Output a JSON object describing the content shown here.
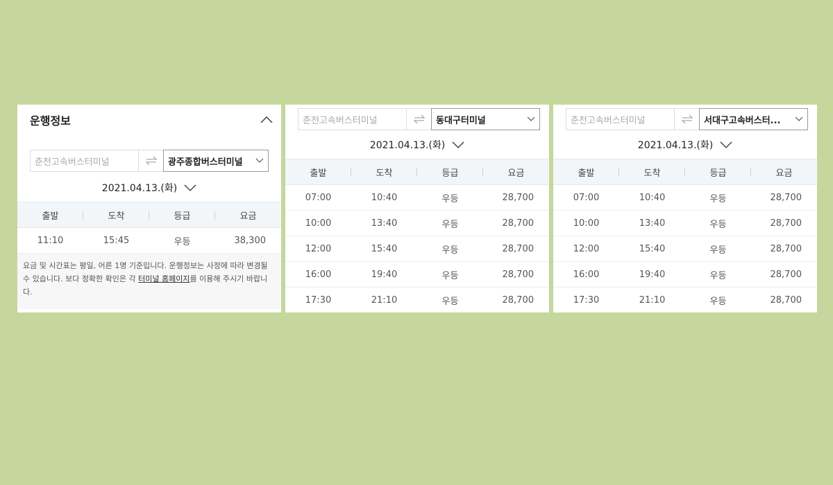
{
  "panel1": {
    "title": "운행정보",
    "origin": "춘천고속버스터미널",
    "destination": "광주종합버스터미널",
    "date": "2021.04.13.(화)",
    "columns": [
      "출발",
      "도착",
      "등급",
      "요금"
    ],
    "rows": [
      {
        "depart": "11:10",
        "arrive": "15:45",
        "grade": "우등",
        "fare": "38,300"
      }
    ],
    "note_before": "요금 및 시간표는 평일, 어른 1명 기준입니다. 운행정보는 사정에 따라 변경될 수 있습니다. 보다 정확한 확인은 각 ",
    "note_link": "터미널 홈페이지",
    "note_after": "를 이용해 주시기 바랍니다."
  },
  "panel2": {
    "origin": "춘천고속버스터미널",
    "destination": "동대구터미널",
    "date": "2021.04.13.(화)",
    "columns": [
      "출발",
      "도착",
      "등급",
      "요금"
    ],
    "rows": [
      {
        "depart": "07:00",
        "arrive": "10:40",
        "grade": "우등",
        "fare": "28,700"
      },
      {
        "depart": "10:00",
        "arrive": "13:40",
        "grade": "우등",
        "fare": "28,700"
      },
      {
        "depart": "12:00",
        "arrive": "15:40",
        "grade": "우등",
        "fare": "28,700"
      },
      {
        "depart": "16:00",
        "arrive": "19:40",
        "grade": "우등",
        "fare": "28,700"
      },
      {
        "depart": "17:30",
        "arrive": "21:10",
        "grade": "우등",
        "fare": "28,700"
      }
    ]
  },
  "panel3": {
    "origin": "춘천고속버스터미널",
    "destination": "서대구고속버스터...",
    "date": "2021.04.13.(화)",
    "columns": [
      "출발",
      "도착",
      "등급",
      "요금"
    ],
    "rows": [
      {
        "depart": "07:00",
        "arrive": "10:40",
        "grade": "우등",
        "fare": "28,700"
      },
      {
        "depart": "10:00",
        "arrive": "13:40",
        "grade": "우등",
        "fare": "28,700"
      },
      {
        "depart": "12:00",
        "arrive": "15:40",
        "grade": "우등",
        "fare": "28,700"
      },
      {
        "depart": "16:00",
        "arrive": "19:40",
        "grade": "우등",
        "fare": "28,700"
      },
      {
        "depart": "17:30",
        "arrive": "21:10",
        "grade": "우등",
        "fare": "28,700"
      }
    ]
  },
  "icons": {
    "collapse": "chevron-up-icon",
    "swap": "swap-arrows-icon",
    "dropdown": "chevron-down-icon",
    "date": "chevron-down-icon"
  }
}
